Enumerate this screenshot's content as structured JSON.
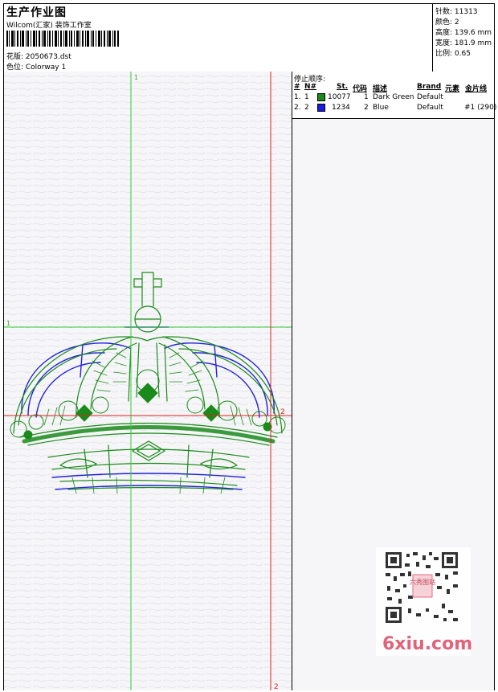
{
  "header": {
    "title": "生产作业图",
    "studio": "Wilcom(汇家) 装饰工作室",
    "design_line": "花版: 2050673.dst",
    "colorway_line": "色位: Colorway 1"
  },
  "stats": {
    "stitches": "针数: 11313",
    "colors": "颜色: 2",
    "height": "高度: 139.6 mm",
    "width": "宽度: 181.9 mm",
    "scale": "比例: 0.65"
  },
  "stop_sequence": {
    "label": "停止顺序:",
    "columns": [
      "#",
      "N#",
      "St.",
      "代码",
      "描述",
      "Brand",
      "元素",
      "金片线"
    ],
    "rows": [
      {
        "n": "1.",
        "needle": "1",
        "stitches": "10077",
        "code": "1",
        "description": "Dark Green",
        "brand": "Default",
        "element": "",
        "sequin": "",
        "color": "#1a8a1a"
      },
      {
        "n": "2.",
        "needle": "2",
        "stitches": "1234",
        "code": "2",
        "description": "Blue",
        "brand": "Default",
        "element": "",
        "sequin": "#1 (290)",
        "color": "#1a1ae0"
      }
    ]
  },
  "guides": {
    "green_vertical_label": "1",
    "green_horizontal_label": "1",
    "red_horizontal_label": "2",
    "red_vertical_label": "2"
  },
  "watermark": {
    "text": "6xiu.com",
    "stamp": "六秀图站"
  },
  "colors": {
    "green": "#1a8a1a",
    "blue": "#2222dd",
    "guide_green": "#33cc33",
    "guide_red": "#dd2222"
  }
}
